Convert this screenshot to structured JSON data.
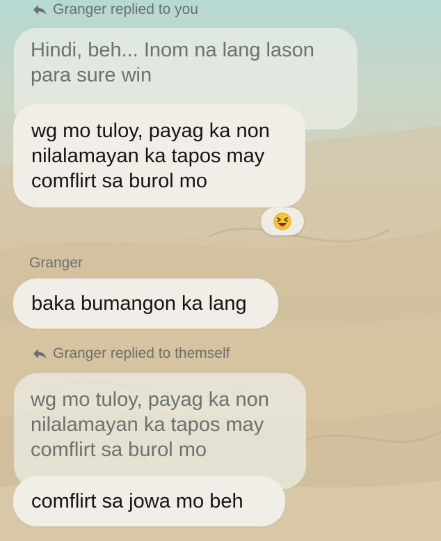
{
  "thread": {
    "reply_context_1": "Granger replied to you",
    "quoted_message_1": [
      "Hindi, beh... Inom na lang lason",
      "para sure win"
    ],
    "message_1": [
      "wg mo tuloy, payag ka non",
      "nilalamayan ka tapos may",
      "comflirt sa burol mo"
    ],
    "message_1_reaction": "😆",
    "sender_name": "Granger",
    "message_2": "baka bumangon ka lang",
    "reply_context_2": "Granger replied to themself",
    "quoted_message_2": [
      "wg mo tuloy, payag ka non",
      "nilalamayan ka tapos may",
      "comflirt sa burol mo"
    ],
    "message_3": "comflirt sa jowa mo beh"
  },
  "icons": {
    "reply_arrow": "reply-arrow-icon",
    "reaction": "laughing-emoji-icon"
  }
}
